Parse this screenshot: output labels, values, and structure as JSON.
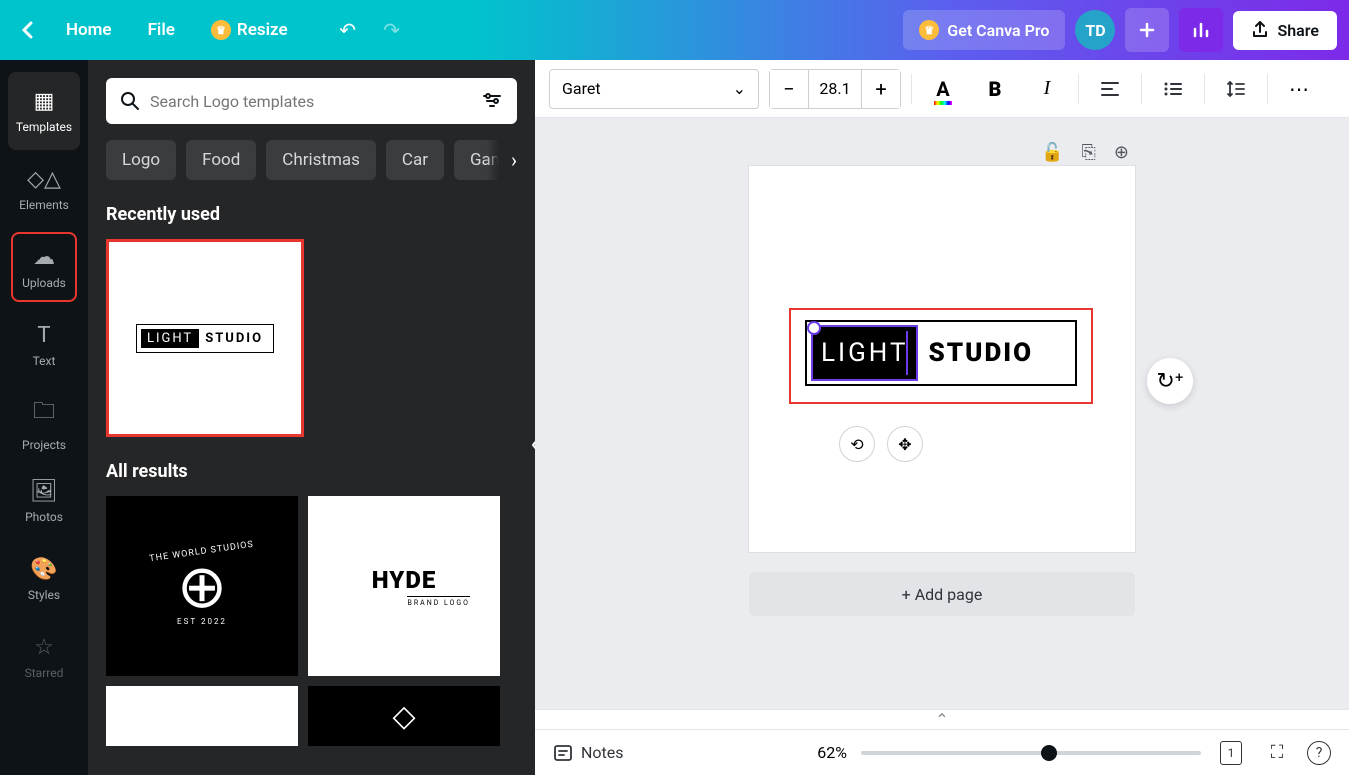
{
  "top": {
    "home": "Home",
    "file": "File",
    "resize": "Resize",
    "pro": "Get Canva Pro",
    "avatar": "TD",
    "share": "Share"
  },
  "rail": {
    "templates": "Templates",
    "elements": "Elements",
    "uploads": "Uploads",
    "text": "Text",
    "projects": "Projects",
    "photos": "Photos",
    "styles": "Styles",
    "starred": "Starred"
  },
  "panel": {
    "search_placeholder": "Search Logo templates",
    "chips": [
      "Logo",
      "Food",
      "Christmas",
      "Car",
      "Gaming"
    ],
    "recently_used": "Recently used",
    "all_results": "All results",
    "recent_light": "LIGHT",
    "recent_studio": "STUDIO",
    "world_top": "THE WORLD STUDIOS",
    "world_est": "EST 2022",
    "hyde": "HYDE",
    "hyde_sub": "BRAND LOGO"
  },
  "toolbar": {
    "font": "Garet",
    "size": "28.1"
  },
  "canvas": {
    "light": "LIGHT",
    "studio": "STUDIO",
    "add_page": "+ Add page"
  },
  "bottom": {
    "notes": "Notes",
    "zoom": "62%",
    "page": "1"
  }
}
